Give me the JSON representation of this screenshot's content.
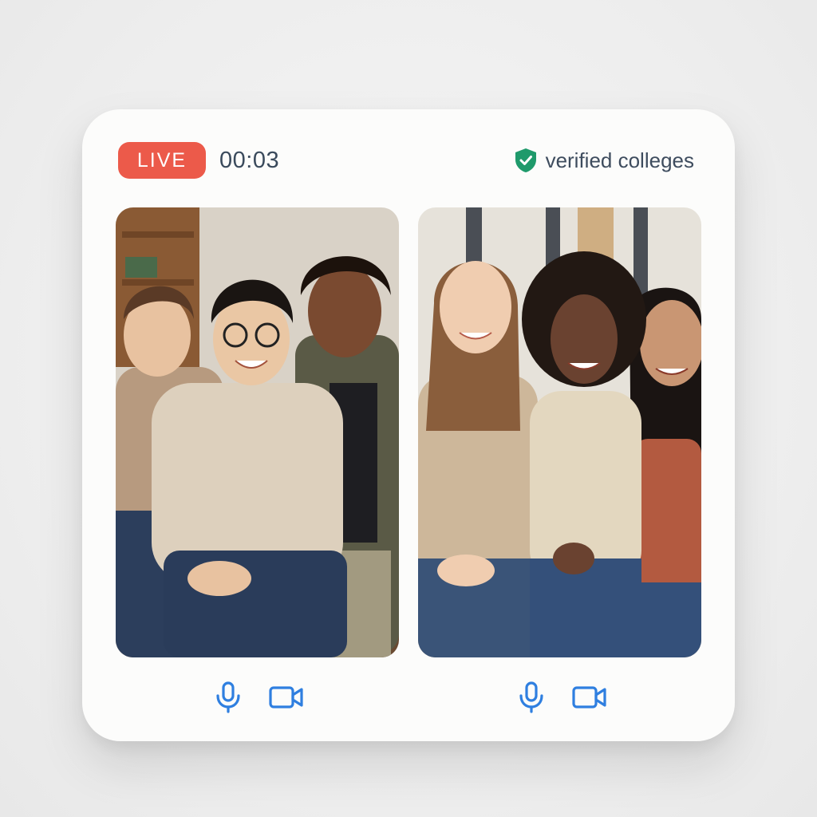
{
  "status": {
    "live_label": "LIVE",
    "timer": "00:03"
  },
  "verified": {
    "label": "verified colleges",
    "icon": "shield-check-icon",
    "color": "#1f9a6b"
  },
  "tiles": [
    {
      "controls": [
        {
          "icon": "microphone-icon"
        },
        {
          "icon": "video-camera-icon"
        }
      ]
    },
    {
      "controls": [
        {
          "icon": "microphone-icon"
        },
        {
          "icon": "video-camera-icon"
        }
      ]
    }
  ],
  "colors": {
    "live": "#ec5a4a",
    "control_icon": "#2f7fe0",
    "text": "#3a4a5c"
  }
}
